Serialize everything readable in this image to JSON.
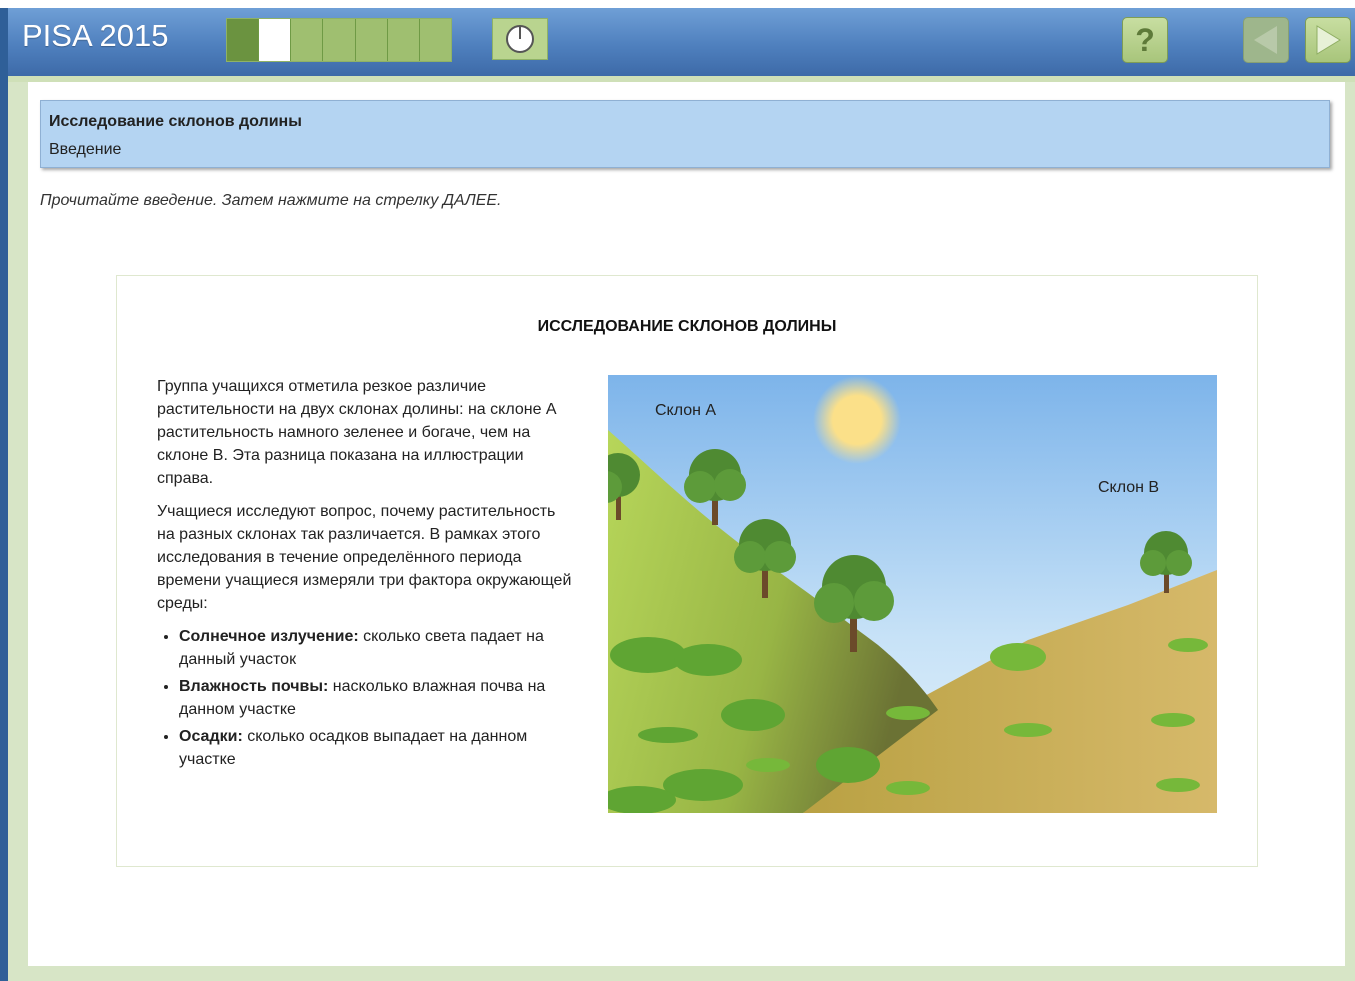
{
  "header": {
    "brand": "PISA 2015",
    "progress": {
      "total": 7,
      "current": 2
    },
    "help_label": "?"
  },
  "unit": {
    "title": "Исследование склонов долины",
    "subtitle": "Введение"
  },
  "instruction": "Прочитайте введение. Затем нажмите на стрелку ДАЛЕЕ.",
  "stimulus": {
    "title": "ИССЛЕДОВАНИЕ СКЛОНОВ ДОЛИНЫ",
    "paragraph1": "Группа учащихся отметила резкое различие растительности на двух склонах долины: на склоне A растительность намного зеленее и богаче, чем на склоне B. Эта разница показана на иллюстрации справа.",
    "paragraph2": "Учащиеся исследуют вопрос, почему растительность на разных склонах так различается. В рамках этого исследования в течение определённого периода времени учащиеся измеряли три фактора окружающей среды:",
    "factors": [
      {
        "term": "Солнечное излучение:",
        "desc": " сколько света падает на данный участок"
      },
      {
        "term": "Влажность почвы:",
        "desc": " насколько влажная почва на данном участке"
      },
      {
        "term": "Осадки:",
        "desc": " сколько осадков выпадает на данном участке"
      }
    ],
    "illustration": {
      "slope_a_label": "Склон А",
      "slope_b_label": "Склон В"
    }
  },
  "colors": {
    "topbar": "#4f80be",
    "frame": "#d7e5c6",
    "unit_header": "#b4d4f2",
    "progress_done": "#6b9340",
    "progress_todo": "#9fbf70"
  },
  "icons": [
    "timer-icon",
    "help-icon",
    "back-arrow-icon",
    "next-arrow-icon"
  ]
}
